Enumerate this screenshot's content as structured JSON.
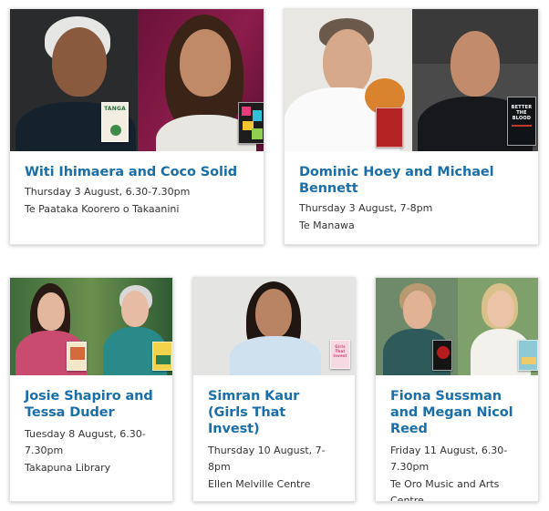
{
  "events": [
    {
      "title": "Witi Ihimaera and Coco Solid",
      "date": "Thursday 3 August, 6.30-7.30pm",
      "venue": "Te Paataka Koorero o Takaanini",
      "books": [
        "TANGA",
        ""
      ]
    },
    {
      "title": "Dominic Hoey and Michael Bennett",
      "date": "Thursday 3 August, 7-8pm",
      "venue": "Te Manawa",
      "books": [
        "",
        "BETTER THE BLOOD"
      ]
    },
    {
      "title": "Josie Shapiro and Tessa Duder",
      "date": "Tuesday 8 August, 6.30-7.30pm",
      "venue": "Takapuna Library",
      "books": [
        "",
        ""
      ]
    },
    {
      "title": "Simran Kaur (Girls That Invest)",
      "date": "Thursday 10 August, 7-8pm",
      "venue": "Ellen Melville Centre",
      "books": [
        "Girls That Invest"
      ]
    },
    {
      "title": "Fiona Sussman and Megan Nicol Reed",
      "date": "Friday 11 August, 6.30-7.30pm",
      "venue": "Te Oro Music and Arts Centre",
      "books": [
        "",
        ""
      ]
    }
  ],
  "colors": {
    "title_link": "#1a6fa8",
    "body_text": "#333333",
    "card_border": "#e3e3e3"
  }
}
